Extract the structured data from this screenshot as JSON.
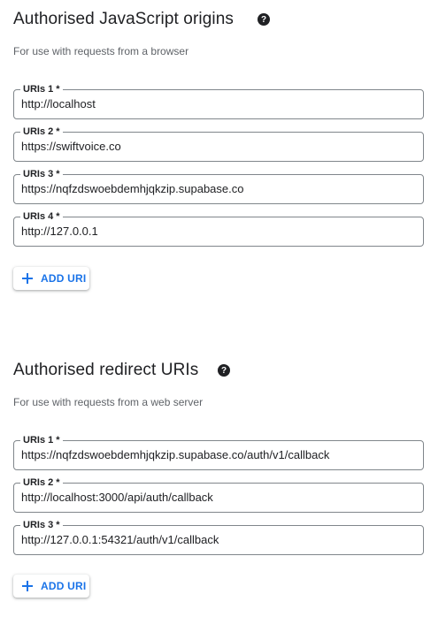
{
  "js_origins": {
    "title": "Authorised JavaScript origins",
    "subtitle": "For use with requests from a browser",
    "help_icon": "help-circle-icon",
    "fields": [
      {
        "label": "URIs 1 *",
        "value": "http://localhost"
      },
      {
        "label": "URIs 2 *",
        "value": "https://swiftvoice.co"
      },
      {
        "label": "URIs 3 *",
        "value": "https://nqfzdswoebdemhjqkzip.supabase.co"
      },
      {
        "label": "URIs 4 *",
        "value": "http://127.0.0.1"
      }
    ],
    "add_button": {
      "label": "ADD URI",
      "icon": "plus-icon"
    }
  },
  "redirect_uris": {
    "title": "Authorised redirect URIs",
    "subtitle": "For use with requests from a web server",
    "help_icon": "help-circle-icon",
    "fields": [
      {
        "label": "URIs 1 *",
        "value": "https://nqfzdswoebdemhjqkzip.supabase.co/auth/v1/callback"
      },
      {
        "label": "URIs 2 *",
        "value": "http://localhost:3000/api/auth/callback"
      },
      {
        "label": "URIs 3 *",
        "value": "http://127.0.0.1:54321/auth/v1/callback"
      }
    ],
    "add_button": {
      "label": "ADD URI",
      "icon": "plus-icon"
    }
  },
  "colors": {
    "accent": "#1a73e8",
    "text": "#202124",
    "secondary_text": "#5f6368",
    "border": "#80868b"
  }
}
